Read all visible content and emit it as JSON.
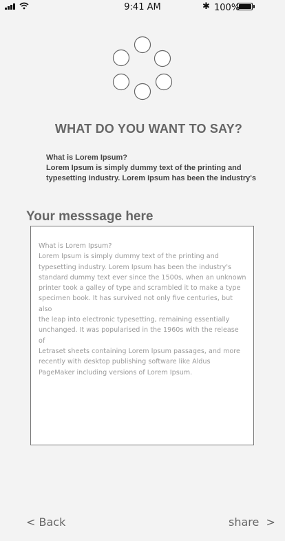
{
  "status_bar": {
    "time": "9:41 AM",
    "battery_percent": "100%",
    "icons": [
      "signal-icon",
      "wifi-icon",
      "bluetooth-icon",
      "battery-icon"
    ]
  },
  "loader": {
    "icon": "loading-spinner-icon",
    "dots": 6
  },
  "heading": "WHAT DO YOU WANT TO SAY?",
  "intro": {
    "question": "What is Lorem Ipsum?",
    "line1": "Lorem Ipsum is simply dummy text of the printing and",
    "line2": "typesetting industry. Lorem Ipsum has been the industry's"
  },
  "message": {
    "label": "Your messsage here",
    "lines": [
      "What is Lorem Ipsum?",
      "Lorem Ipsum is simply dummy text of the printing and",
      "typesetting industry. Lorem Ipsum has been the industry's",
      "standard dummy text ever since the 1500s, when an unknown",
      "printer took a galley of type and scrambled it to make a type",
      "specimen book. It has survived not only five centuries, but also",
      "the leap into electronic typesetting, remaining essentially",
      "unchanged. It was popularised in the 1960s with the release of",
      "Letraset sheets containing Lorem Ipsum passages, and more",
      "recently with desktop publishing software like Aldus",
      "PageMaker including versions of Lorem Ipsum."
    ]
  },
  "nav": {
    "back_label": "< Back",
    "share_label": "share  >"
  }
}
